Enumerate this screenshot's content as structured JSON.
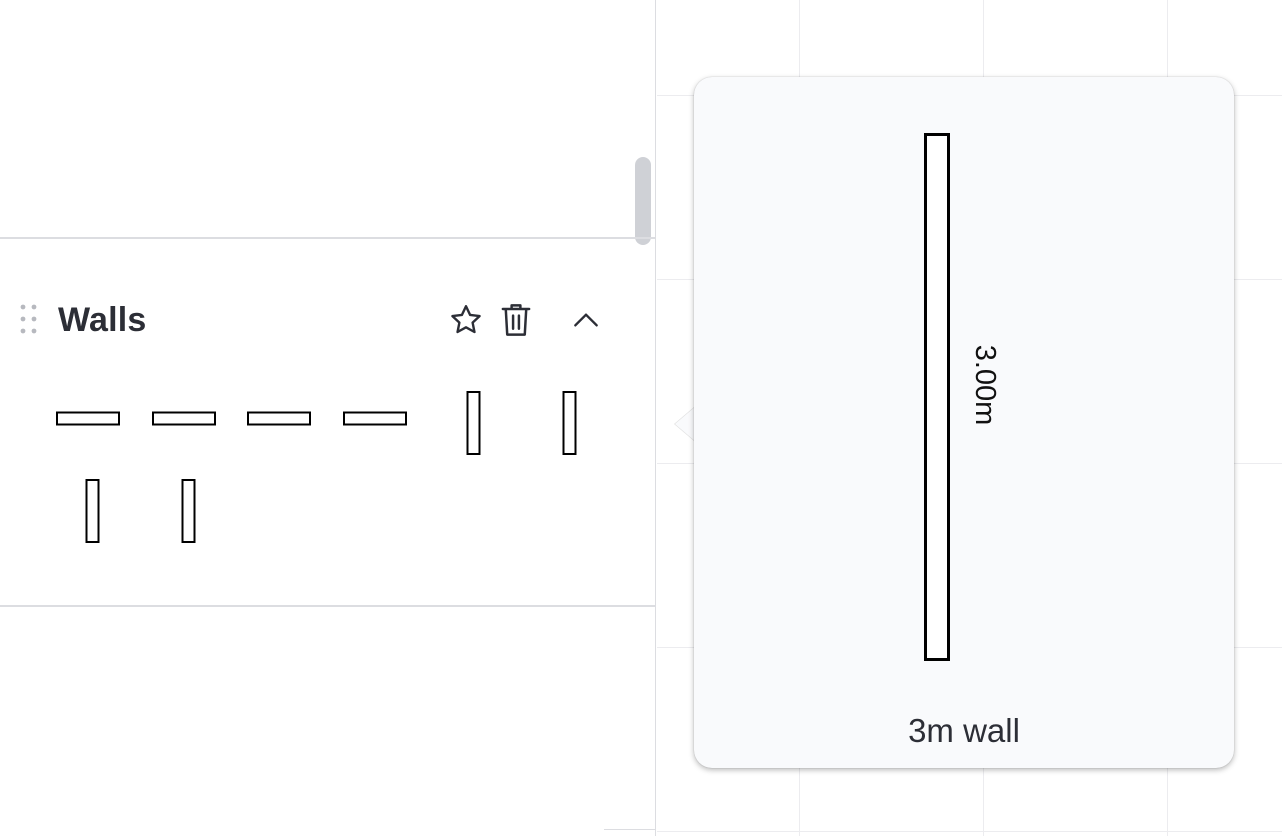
{
  "section": {
    "title": "Walls",
    "icons": {
      "drag": "drag-handle-icon",
      "favorite": "star-icon",
      "delete": "trash-icon",
      "collapse": "chevron-up-icon"
    }
  },
  "shapes": [
    {
      "orientation": "horizontal"
    },
    {
      "orientation": "horizontal"
    },
    {
      "orientation": "horizontal"
    },
    {
      "orientation": "horizontal"
    },
    {
      "orientation": "vertical"
    },
    {
      "orientation": "vertical"
    },
    {
      "orientation": "vertical"
    },
    {
      "orientation": "vertical"
    }
  ],
  "preview": {
    "dimension_label": "3.00m",
    "caption": "3m wall"
  },
  "colors": {
    "title": "#2c2e36",
    "popover_bg": "#f9fafc",
    "divider": "#dcdde1",
    "shape_stroke": "#000000"
  }
}
